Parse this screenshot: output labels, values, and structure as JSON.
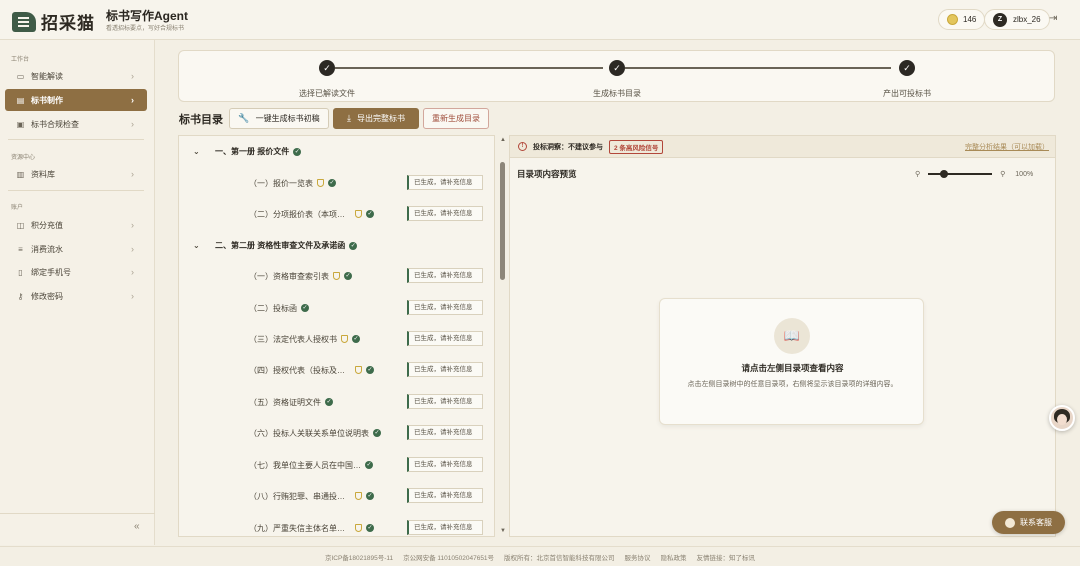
{
  "brand": {
    "logo_text": "招采猫",
    "app_title": "标书写作Agent",
    "app_subtitle": "看透招标要点，写好合规标书"
  },
  "header": {
    "credits": "146",
    "user_initial": "Z",
    "username": "zlbx_26"
  },
  "sidebar": {
    "sections": [
      {
        "label": "工作台",
        "items": [
          {
            "label": "智能解读",
            "icon": "chat-icon",
            "active": false
          },
          {
            "label": "标书制作",
            "icon": "document-icon",
            "active": true
          },
          {
            "label": "标书合规检查",
            "icon": "check-icon",
            "active": false
          }
        ]
      },
      {
        "label": "资源中心",
        "items": [
          {
            "label": "资料库",
            "icon": "library-icon",
            "active": false
          }
        ]
      },
      {
        "label": "账户",
        "items": [
          {
            "label": "积分充值",
            "icon": "wallet-icon",
            "active": false
          },
          {
            "label": "消费流水",
            "icon": "bill-icon",
            "active": false
          },
          {
            "label": "绑定手机号",
            "icon": "phone-icon",
            "active": false
          },
          {
            "label": "修改密码",
            "icon": "key-icon",
            "active": false
          }
        ]
      }
    ],
    "collapse_label": "«"
  },
  "stepper": {
    "steps": [
      {
        "label": "选择已解读文件",
        "done": true
      },
      {
        "label": "生成标书目录",
        "done": true
      },
      {
        "label": "产出可投标书",
        "done": true
      }
    ]
  },
  "toolbar": {
    "title": "标书目录",
    "generate_draft": "一键生成标书初稿",
    "export_full": "导出完整标书",
    "regenerate": "重新生成目录"
  },
  "tree": {
    "chapters": [
      {
        "title": "一、第一册 报价文件",
        "items": [
          {
            "label": "（一）报价一览表",
            "shield": true,
            "status": "已生成，请补充信息"
          },
          {
            "label": "（二）分项报价表（本项目不适...",
            "shield": true,
            "status": "已生成，请补充信息"
          }
        ]
      },
      {
        "title": "二、第二册 资格性审查文件及承诺函",
        "items": [
          {
            "label": "（一）资格审查索引表",
            "shield": true,
            "status": "已生成，请补充信息"
          },
          {
            "label": "（二）投标函",
            "shield": false,
            "status": "已生成，请补充信息"
          },
          {
            "label": "（三）法定代表人授权书",
            "shield": true,
            "status": "已生成，请补充信息"
          },
          {
            "label": "（四）授权代表（投标及谈判）...",
            "shield": true,
            "status": "已生成，请补充信息"
          },
          {
            "label": "（五）资格证明文件",
            "shield": false,
            "status": "已生成，请补充信息"
          },
          {
            "label": "（六）投标人关联关系单位说明表",
            "shield": false,
            "status": "已生成，请补充信息"
          },
          {
            "label": "（七）我单位主要人员在中国工商...",
            "shield": false,
            "status": "已生成，请补充信息"
          },
          {
            "label": "（八）行贿犯罪、串通投标犯罪...",
            "shield": true,
            "status": "已生成，请补充信息"
          },
          {
            "label": "（九）严重失信主体名单记录查...",
            "shield": true,
            "status": "已生成，请补充信息"
          }
        ]
      }
    ]
  },
  "alert": {
    "prefix": "投标洞察：不建议参与",
    "badge": "2 条高风险信号",
    "link": "完整分析结果（可以加载）"
  },
  "preview": {
    "title": "目录项内容预览",
    "zoom_percent": "100%",
    "zoom_level": 0.25,
    "empty_title": "请点击左侧目录项查看内容",
    "empty_desc": "点击左侧目录树中的任意目录项，右侧将显示该目录项的详细内容。"
  },
  "contact_label": "联系客服",
  "footer": {
    "items": [
      "京ICP备18021895号-11",
      "京公网安备 11010502047651号",
      "版权所有：北京首信智能科技有限公司",
      "服务协议",
      "隐私政策",
      "友情链接：知了标讯"
    ]
  },
  "colors": {
    "accent": "#8e6f43",
    "success": "#3e6b4b",
    "danger": "#b2473a",
    "background": "#f3efe4"
  }
}
